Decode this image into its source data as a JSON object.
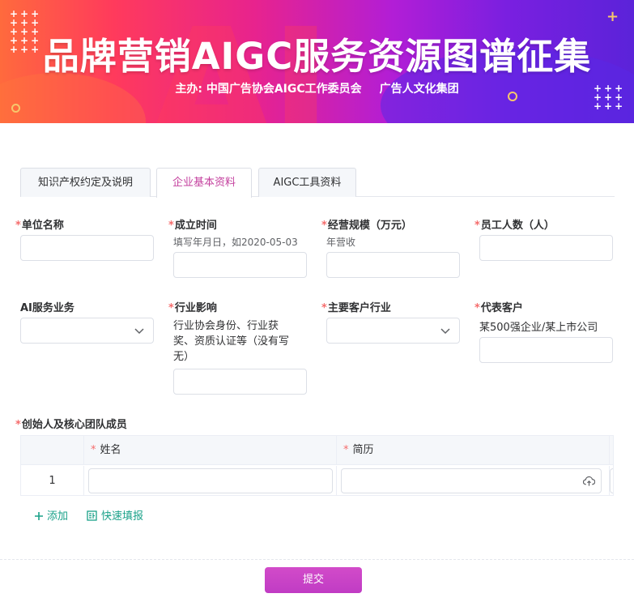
{
  "banner": {
    "title": "品牌营销AIGC服务资源图谱征集",
    "subtitle_left": "主办: 中国广告协会AIGC工作委员会",
    "subtitle_right": "广告人文化集团",
    "watermark": "AI"
  },
  "tabs": [
    {
      "label": "知识产权约定及说明",
      "active": false
    },
    {
      "label": "企业基本资料",
      "active": true
    },
    {
      "label": "AIGC工具资料",
      "active": false
    }
  ],
  "fields": {
    "company_name": {
      "label": "单位名称",
      "required": true,
      "value": ""
    },
    "founded_date": {
      "label": "成立时间",
      "required": true,
      "hint": "填写年月日，如2020-05-03",
      "value": ""
    },
    "business_scale": {
      "label": "经营规模（万元）",
      "required": true,
      "hint": "年营收",
      "value": ""
    },
    "employee_count": {
      "label": "员工人数（人）",
      "required": true,
      "value": ""
    },
    "ai_service": {
      "label": "AI服务业务",
      "required": false,
      "value": ""
    },
    "industry_influence": {
      "label": "行业影响",
      "required": true,
      "hint": "行业协会身份、行业获奖、资质认证等（没有写无）",
      "value": ""
    },
    "client_industry": {
      "label": "主要客户行业",
      "required": true,
      "value": ""
    },
    "representative_clients": {
      "label": "代表客户",
      "required": true,
      "hint": "某500强企业/某上市公司",
      "value": ""
    }
  },
  "team": {
    "label": "创始人及核心团队成员",
    "required": true,
    "columns": [
      "姓名",
      "简历"
    ],
    "rows": [
      {
        "index": "1",
        "name": "",
        "resume": ""
      }
    ]
  },
  "actions": {
    "add_label": "添加",
    "quick_fill_label": "快速填报",
    "submit_label": "提交"
  },
  "colors": {
    "accent": "#c33fc3",
    "active_tab_text": "#c4409e",
    "link": "#1aa189",
    "required_mark": "#f56c6c"
  },
  "icons": [
    "chevron-down-icon",
    "upload-cloud-icon",
    "plus-icon",
    "quick-fill-icon"
  ]
}
